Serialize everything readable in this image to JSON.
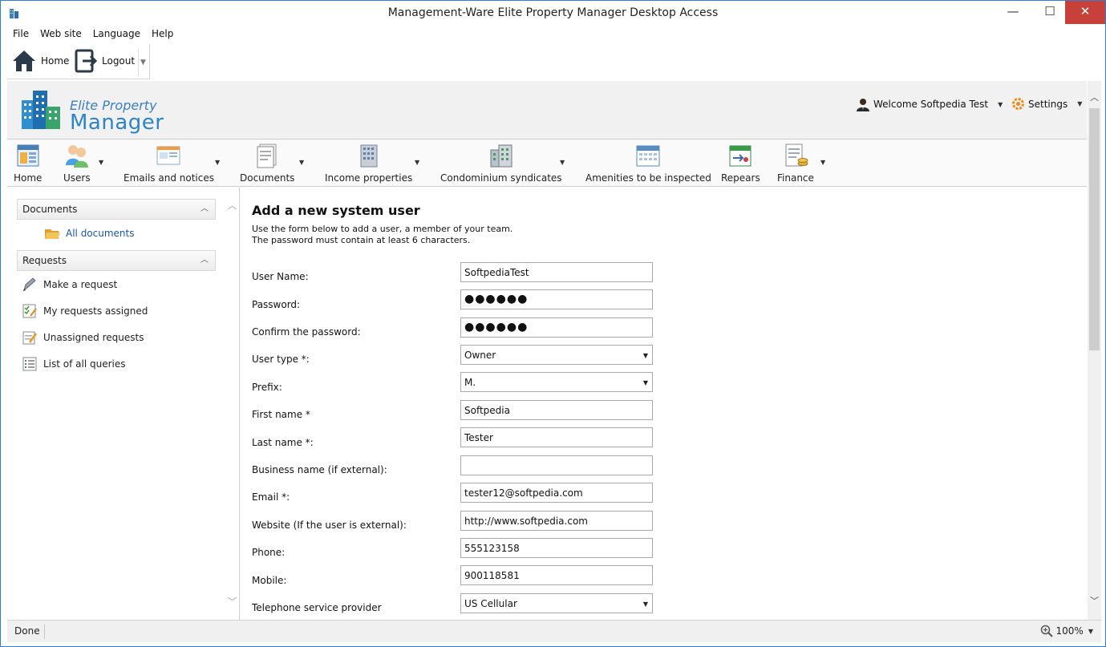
{
  "window": {
    "title": "Management-Ware Elite Property Manager Desktop Access",
    "minimize": "—",
    "maximize": "☐",
    "close": "✕"
  },
  "menu": [
    "File",
    "Web site",
    "Language",
    "Help"
  ],
  "toolbar": {
    "home": "Home",
    "logout": "Logout"
  },
  "header": {
    "logo_line1": "Elite Property",
    "logo_line2": "Manager",
    "welcome": "Welcome Softpedia Test",
    "settings": "Settings"
  },
  "ribbon": [
    "Home",
    "Users",
    "Emails and notices",
    "Documents",
    "Income properties",
    "Condominium syndicates",
    "Amenities to be inspected",
    "Repears",
    "Finance"
  ],
  "sidebar": {
    "documents_header": "Documents",
    "all_documents": "All documents",
    "requests_header": "Requests",
    "requests": [
      "Make a request",
      "My requests assigned",
      "Unassigned requests",
      "List of all queries"
    ]
  },
  "form": {
    "title": "Add a new system user",
    "intro1": "Use the form below to add a user, a member of your team.",
    "intro2": "The password must contain at least 6 characters.",
    "fields": [
      {
        "label": "User Name:",
        "value": "SoftpediaTest"
      },
      {
        "label": "Password:",
        "value": "●●●●●●"
      },
      {
        "label": "Confirm the password:",
        "value": "●●●●●●"
      },
      {
        "label": "User type *:",
        "value": "Owner"
      },
      {
        "label": "Prefix:",
        "value": "M."
      },
      {
        "label": "First name *",
        "value": "Softpedia"
      },
      {
        "label": "Last name *:",
        "value": "Tester"
      },
      {
        "label": "Business name (if external):",
        "value": ""
      },
      {
        "label": "Email *:",
        "value": "tester12@softpedia.com"
      },
      {
        "label": "Website (If the user is external):",
        "value": "http://www.softpedia.com"
      },
      {
        "label": "Phone:",
        "value": "555123158"
      },
      {
        "label": "Mobile:",
        "value": "900118581"
      },
      {
        "label": "Telephone service provider",
        "value": "US Cellular"
      }
    ]
  },
  "status": {
    "text": "Done",
    "zoom": "100%"
  },
  "colors": {
    "accent": "#2e84c8",
    "close": "#c7413a",
    "link": "#1a56a8"
  }
}
